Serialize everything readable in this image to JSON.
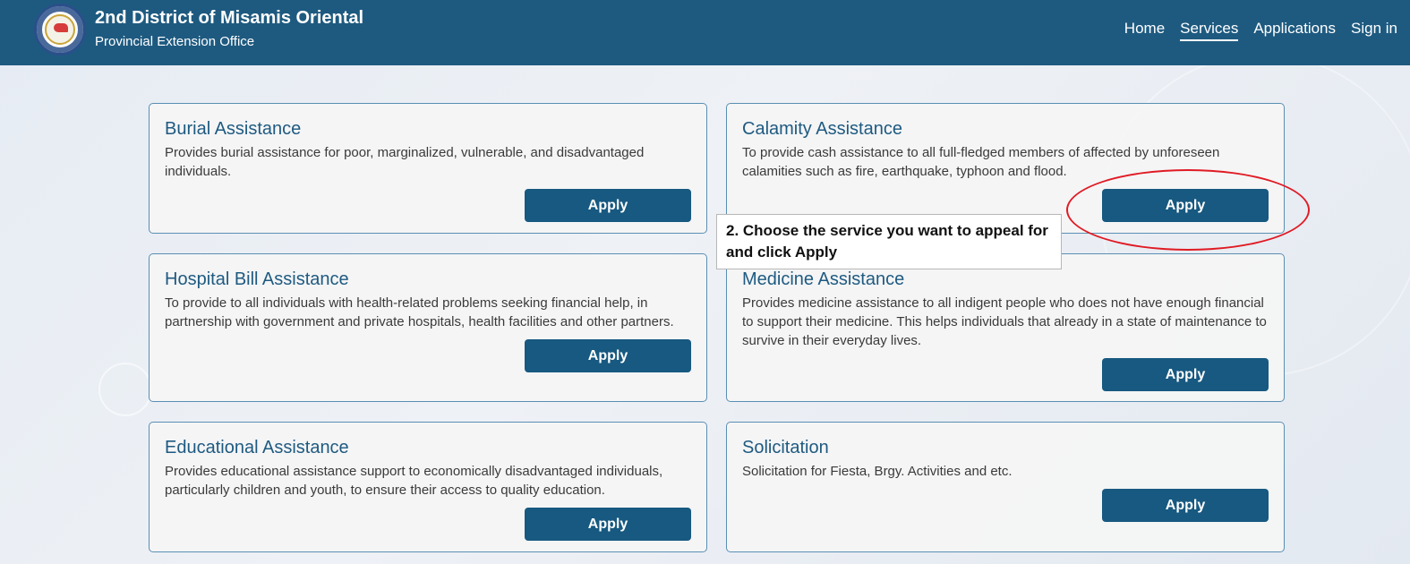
{
  "header": {
    "title": "2nd District of Misamis Oriental",
    "subtitle": "Provincial Extension Office",
    "nav": [
      {
        "label": "Home",
        "active": false
      },
      {
        "label": "Services",
        "active": true
      },
      {
        "label": "Applications",
        "active": false
      },
      {
        "label": "Sign in",
        "active": false
      }
    ],
    "logo_icon": "province-seal-icon",
    "bar_color": "#1e5a80"
  },
  "services": [
    {
      "title": "Burial Assistance",
      "description": "Provides burial assistance for poor, marginalized, vulnerable, and disadvantaged individuals.",
      "button": "Apply"
    },
    {
      "title": "Calamity Assistance",
      "description": "To provide cash assistance to all full-fledged members of affected by unforeseen calamities such as fire, earthquake, typhoon and flood.",
      "button": "Apply"
    },
    {
      "title": "Hospital Bill Assistance",
      "description": "To provide to all individuals with health-related problems seeking financial help, in partnership with government and private hospitals, health facilities and other partners.",
      "button": "Apply"
    },
    {
      "title": "Medicine Assistance",
      "description": "Provides medicine assistance to all indigent people who does not have enough financial to support their medicine. This helps individuals that already in a state of maintenance to survive in their everyday lives.",
      "button": "Apply"
    },
    {
      "title": "Educational Assistance",
      "description": "Provides educational assistance support to economically disadvantaged individuals, particularly children and youth, to ensure their access to quality education.",
      "button": "Apply"
    },
    {
      "title": "Solicitation",
      "description": "Solicitation for Fiesta, Brgy. Activities and etc.",
      "button": "Apply"
    }
  ],
  "annotation": {
    "text": "2. Choose the service you want to appeal for and click Apply",
    "highlight_color": "#e01b24"
  },
  "colors": {
    "accent": "#175980",
    "card_border": "#5a8fb3"
  }
}
